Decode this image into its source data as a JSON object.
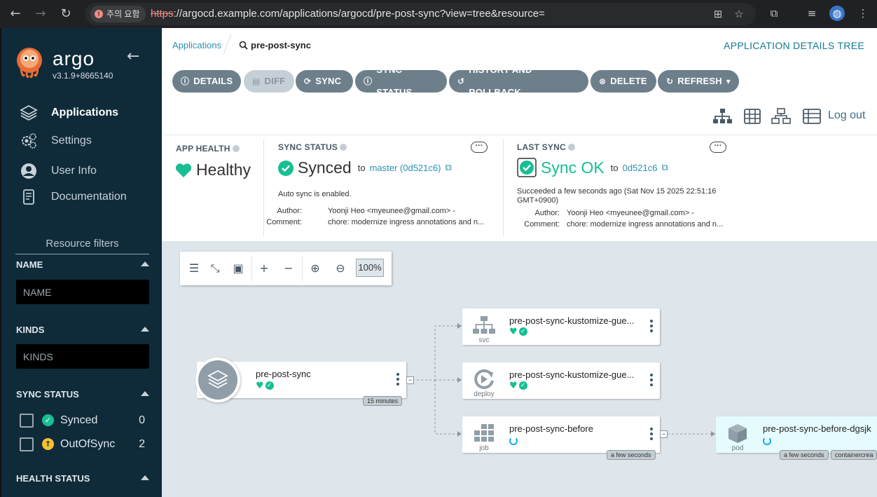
{
  "browser": {
    "security_label": "주의 요함",
    "url_scheme": "https",
    "url_rest": "://argocd.example.com/applications/argocd/pre-post-sync?view=tree&resource="
  },
  "sidebar": {
    "brand": "argo",
    "version": "v3.1.9+8665140",
    "nav": [
      {
        "label": "Applications",
        "icon": "layers-icon",
        "active": true
      },
      {
        "label": "Settings",
        "icon": "gears-icon"
      },
      {
        "label": "User Info",
        "icon": "user-circle-icon"
      },
      {
        "label": "Documentation",
        "icon": "book-icon"
      }
    ],
    "filters_title": "Resource filters",
    "name_filter": {
      "label": "NAME",
      "placeholder": "NAME"
    },
    "kinds_filter": {
      "label": "KINDS",
      "placeholder": "KINDS"
    },
    "sync_status": {
      "label": "SYNC STATUS",
      "options": [
        {
          "label": "Synced",
          "count": "0",
          "color": "#18be94"
        },
        {
          "label": "OutOfSync",
          "count": "2",
          "color": "#f4c030"
        }
      ]
    },
    "health_status_label": "HEALTH STATUS"
  },
  "breadcrumb": {
    "applications": "Applications",
    "current": "pre-post-sync"
  },
  "page_title": "APPLICATION DETAILS TREE",
  "toolbar": {
    "details": "DETAILS",
    "diff": "DIFF",
    "sync": "SYNC",
    "sync_status": "SYNC STATUS",
    "history": "HISTORY AND ROLLBACK",
    "delete": "DELETE",
    "refresh": "REFRESH",
    "logout": "Log out"
  },
  "status": {
    "app_health": {
      "label": "APP HEALTH",
      "value": "Healthy"
    },
    "sync_status": {
      "label": "SYNC STATUS",
      "value": "Synced",
      "to": "to",
      "revision": "master (0d521c6)",
      "auto_sync": "Auto sync is enabled.",
      "author_label": "Author:",
      "author": "Yoonji Heo <myeunee@gmail.com> -",
      "comment_label": "Comment:",
      "comment": "chore: modernize ingress annotations and n..."
    },
    "last_sync": {
      "label": "LAST SYNC",
      "value": "Sync OK",
      "to": "to",
      "revision": "0d521c6",
      "succeeded": "Succeeded a few seconds ago (Sat Nov 15 2025 22:51:16 GMT+0900)",
      "author_label": "Author:",
      "author": "Yoonji Heo <myeunee@gmail.com> -",
      "comment_label": "Comment:",
      "comment": "chore: modernize ingress annotations and n..."
    }
  },
  "graph": {
    "zoom": "100%",
    "app_node": {
      "name": "pre-post-sync",
      "age": "15 minutes"
    },
    "nodes": [
      {
        "name": "pre-post-sync-kustomize-gue...",
        "kind": "svc"
      },
      {
        "name": "pre-post-sync-kustomize-gue...",
        "kind": "deploy"
      },
      {
        "name": "pre-post-sync-before",
        "kind": "job",
        "age": "a few seconds"
      },
      {
        "name": "pre-post-sync-before-dgsjk",
        "kind": "pod",
        "age": "a few seconds",
        "tag2": "containercrea"
      }
    ]
  }
}
